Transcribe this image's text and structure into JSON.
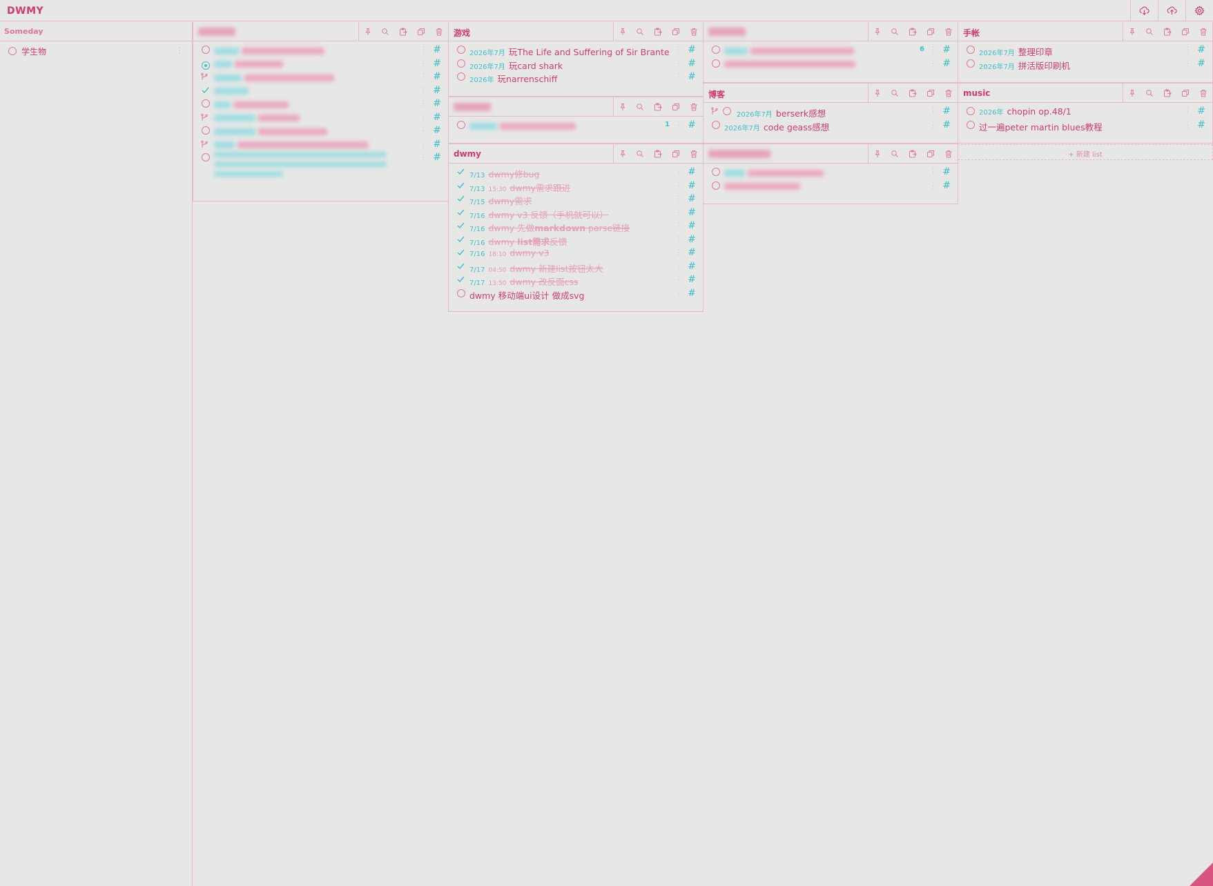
{
  "app": {
    "title": "DWMY",
    "colors": {
      "accent": "#cc3d6e",
      "cyan": "#3fbfca",
      "background": "#e7e7e6",
      "border": "#e8b9c8"
    },
    "actions": [
      {
        "name": "download-icon"
      },
      {
        "name": "upload-icon"
      },
      {
        "name": "settings-icon"
      }
    ]
  },
  "sidebar": {
    "title": "Someday",
    "items": [
      {
        "label": "学生物"
      }
    ]
  },
  "panels": {
    "youxi": {
      "title": "游戏",
      "tasks": [
        {
          "date": "2026年7月",
          "text": "玩The Life and Suffering of Sir Brante"
        },
        {
          "date": "2026年7月",
          "text": "玩card shark"
        },
        {
          "date": "2026年",
          "text": "玩narrenschiff"
        }
      ]
    },
    "shouzhang": {
      "title": "手帐",
      "tasks": [
        {
          "date": "2026年7月",
          "text": "整理印章"
        },
        {
          "date": "2026年7月",
          "text": "拼活版印刷机"
        }
      ]
    },
    "boke": {
      "title": "博客",
      "tasks": [
        {
          "date": "2026年7月",
          "text": "berserk感想"
        },
        {
          "date": "2026年7月",
          "text": "code geass感想"
        }
      ]
    },
    "music": {
      "title": "music",
      "tasks": [
        {
          "date": "2026年",
          "text": "chopin op.48/1"
        },
        {
          "date": "",
          "text": "过一遍peter martin blues教程"
        }
      ]
    },
    "dwmy": {
      "title": "dwmy",
      "tasks": [
        {
          "date": "7/13",
          "time": "",
          "text": "dwmy修bug"
        },
        {
          "date": "7/13",
          "time": "15:30",
          "text": "dwmy需求跟进"
        },
        {
          "date": "7/15",
          "time": "",
          "text": "dwmy需求"
        },
        {
          "date": "7/16",
          "time": "",
          "text": "dwmy v3 反馈（手机就可以）"
        },
        {
          "date": "7/16",
          "time": "",
          "text_pre": "dwmy 先做",
          "text_bold": "markdown",
          "text_post": " parse链接"
        },
        {
          "date": "7/16",
          "time": "",
          "text_pre": "dwmy ",
          "text_bold": "list需求",
          "text_post": "反馈"
        },
        {
          "date": "7/16",
          "time": "18:10",
          "text": "dwmy v3"
        },
        {
          "date": "7/17",
          "time": "04:50",
          "text": "dwmy 新建list按钮太大"
        },
        {
          "date": "7/17",
          "time": "13:50",
          "text": "dwmy 改反面css"
        }
      ],
      "open_task": "dwmy 移动端ui设计 做成svg"
    },
    "blurred_mid": {
      "count": "1"
    },
    "blurred_right": {
      "count": "6"
    }
  },
  "new_list_label": "+ 新建 list"
}
